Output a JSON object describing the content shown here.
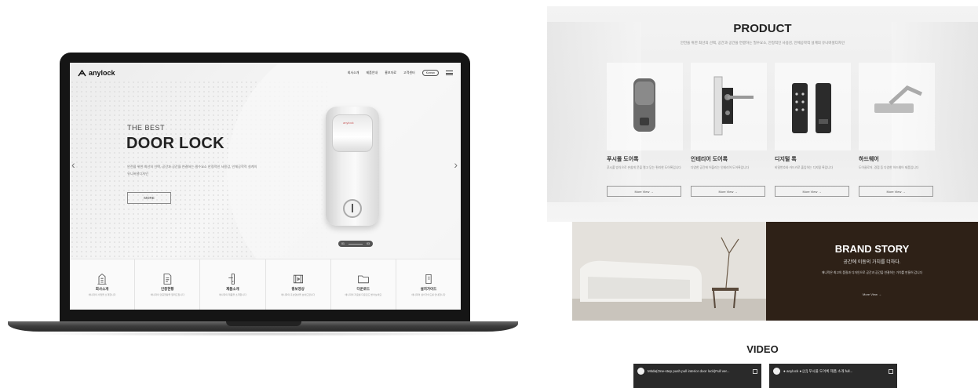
{
  "laptop_site": {
    "logo": "anylock",
    "nav": [
      "회사소개",
      "제품안내",
      "홍보자료",
      "고객센터"
    ],
    "nav_pill": "Korean",
    "hero": {
      "subtitle": "THE BEST",
      "title": "DOOR LOCK",
      "desc": "안전을 위한 최선의 선택, 공간과 공간을 연결하는 필수요소 안정적인 사용감, 인체공학적 설계의 유니버셜디자인",
      "more": "MORE",
      "lock_brand": "anylock"
    },
    "slider": {
      "current": "01",
      "total": "03"
    },
    "quick_links": [
      {
        "title": "회사소개",
        "desc": "애니락의 사업을 소개합니다",
        "icon": "building-icon"
      },
      {
        "title": "인증현황",
        "desc": "애니락의 인증현황을 알려드립니다",
        "icon": "certificate-icon"
      },
      {
        "title": "제품소개",
        "desc": "애니락의 제품을 소개합니다",
        "icon": "door-lever-icon"
      },
      {
        "title": "홍보영상",
        "desc": "애니락의 홍보영상을 보여드립니다",
        "icon": "film-icon"
      },
      {
        "title": "다운로드",
        "desc": "애니락의 자료를 다운로드 받아보세요",
        "icon": "folder-icon"
      },
      {
        "title": "설치가이드",
        "desc": "애니락의 설치가이드를 안내합니다",
        "icon": "install-guide-icon"
      }
    ]
  },
  "product": {
    "title": "PRODUCT",
    "subtitle": "안전을 위한 최선의 선택, 공간과 공간을 연결하는 필수요소, 안정적인 사용감, 인체공학적 설계의 유니버셜디자인",
    "cards": [
      {
        "name": "푸시풀 도어록",
        "desc": "푸시풀 방식으로 손쉽게 문을 열고 닫는 편리한 도어록입니다",
        "more": "More View →"
      },
      {
        "name": "인테리어 도어록",
        "desc": "다양한 공간에 어울리는 인테리어 도어록입니다",
        "more": "More View →"
      },
      {
        "name": "디지털 록",
        "desc": "비밀번호와 카드키로 출입하는 디지털 록입니다",
        "more": "More View →"
      },
      {
        "name": "하드웨어",
        "desc": "도어클로저, 경첩 등 다양한 하드웨어 제품입니다",
        "more": "More View →"
      }
    ]
  },
  "brand_story": {
    "title": "BRAND STORY",
    "subtitle": "공간에 이동의 가치를 더하다.",
    "desc": "애니락은 최고의 품질과 디자인으로 공간과 공간을 연결하는 가치를 만들어 갑니다",
    "more": "More View →"
  },
  "video": {
    "title": "VIDEO",
    "items": [
      {
        "title": "Mitda(One-step push pull interior door lock)Full ver..."
      },
      {
        "title": "● anylock ● [신] 푸시풀 도어록 제품 소개 full..."
      }
    ]
  },
  "colors": {
    "brand_story_bg": "#2e2117",
    "laptop_frame": "#151515",
    "video_thumb_bg": "#2a2a2a"
  }
}
